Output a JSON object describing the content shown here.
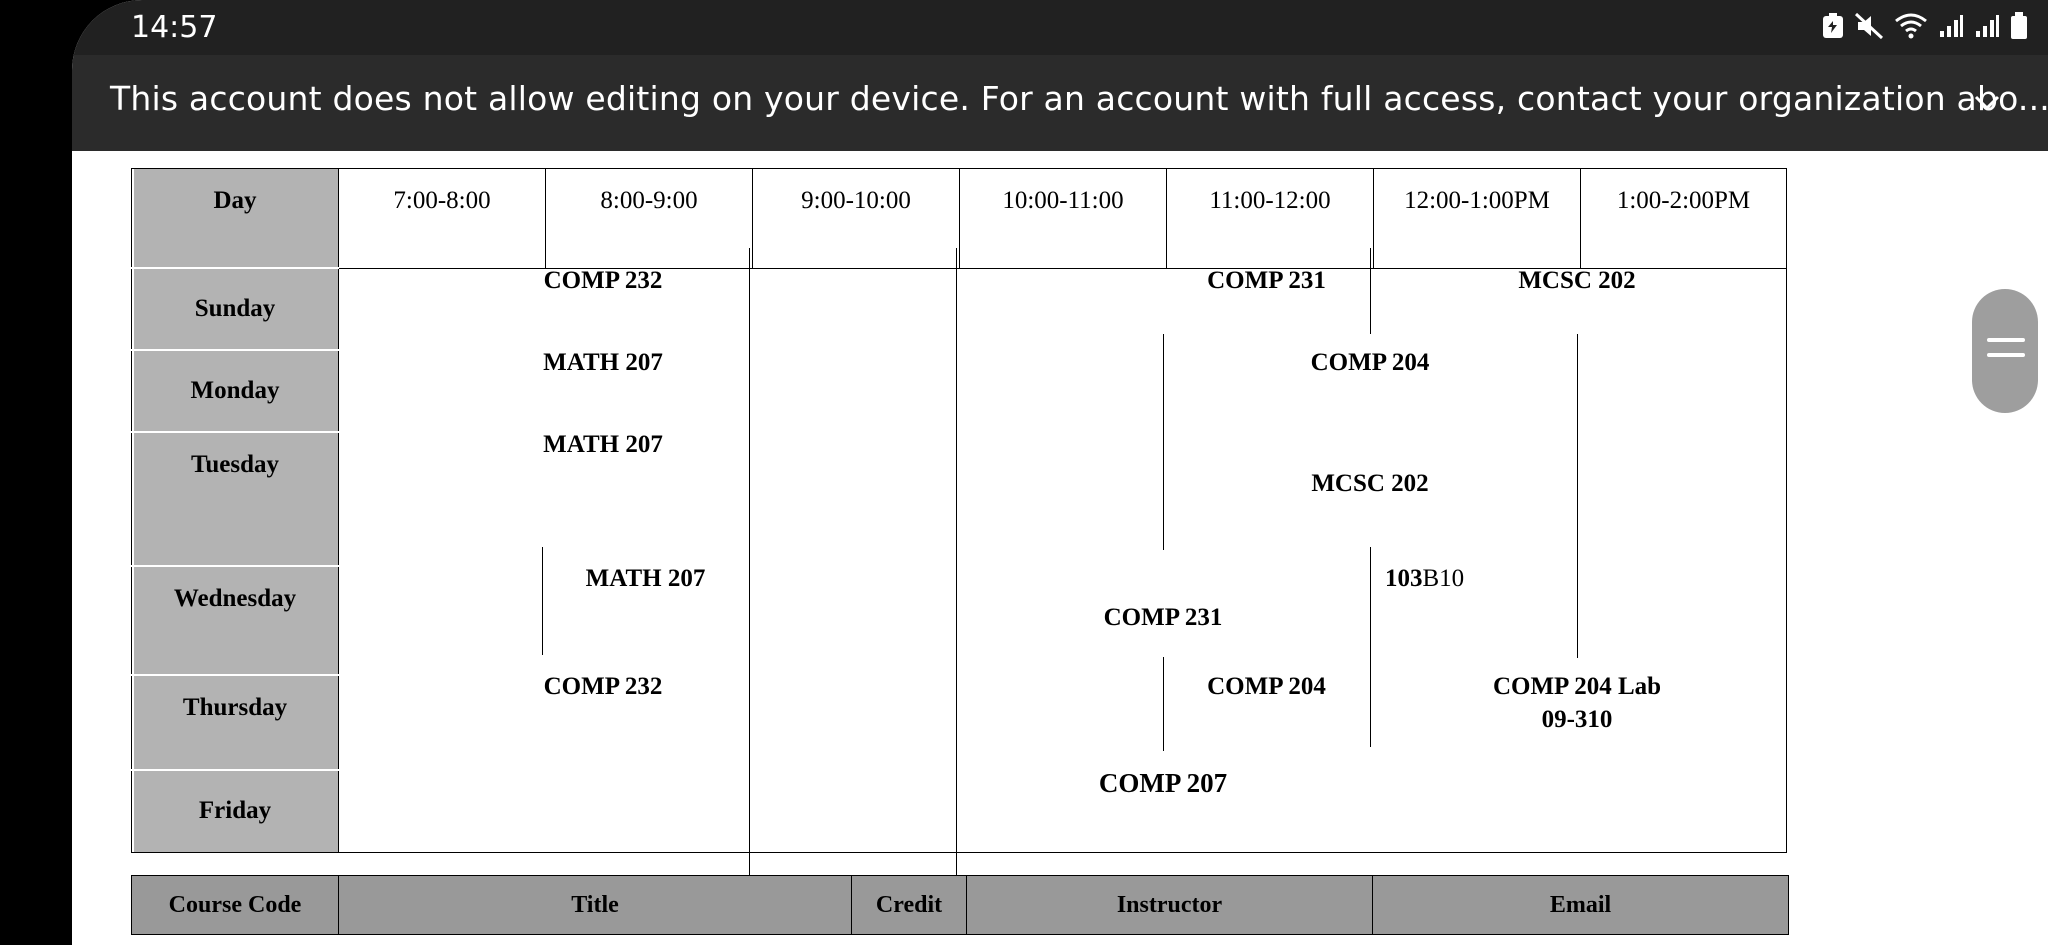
{
  "status_bar": {
    "time": "14:57",
    "icons": [
      "battery-saver-icon",
      "mute-icon",
      "wifi-icon",
      "signal-icon",
      "signal-icon",
      "battery-icon"
    ]
  },
  "banner": {
    "message": "This account does not allow editing on your device. For an account with full access, contact your organization abo..."
  },
  "schedule": {
    "header": {
      "day": "Day",
      "slots": [
        "7:00-8:00",
        "8:00-9:00",
        "9:00-10:00",
        "10:00-11:00",
        "11:00-12:00",
        "12:00-1:00PM",
        "1:00-2:00PM"
      ]
    },
    "days": [
      "Sunday",
      "Monday",
      "Tuesday",
      "Wednesday",
      "Thursday",
      "Friday"
    ],
    "entries": {
      "sunday_1": "COMP 232",
      "sunday_2": "COMP 231",
      "sunday_3": "MCSC 202",
      "monday_1": "MATH 207",
      "monday_2": "COMP 204",
      "tuesday_1": "MATH 207",
      "tuesday_2": "MCSC 202",
      "wednesday_1": "MATH 207",
      "wednesday_2": "COMP 231",
      "wednesday_room_bold": "103",
      "wednesday_room_rest": "B10",
      "thursday_1": "COMP 232",
      "thursday_2": "COMP 204",
      "thursday_3_line1": "COMP 204 Lab",
      "thursday_3_line2": "09-310",
      "friday_1": "COMP 207"
    }
  },
  "courses_table": {
    "headers": [
      "Course Code",
      "Title",
      "Credit",
      "Instructor",
      "Email"
    ]
  }
}
